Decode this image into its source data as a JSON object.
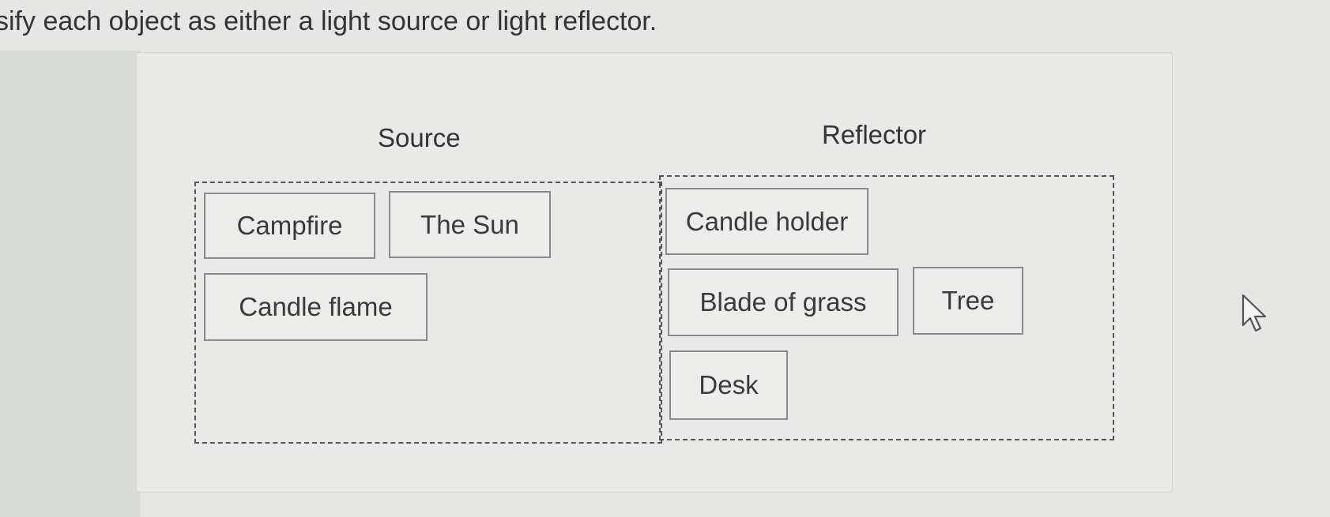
{
  "instructions": "sify each object as either a light source or light reflector.",
  "categories": {
    "source": {
      "heading": "Source",
      "items": [
        "Campfire",
        "The Sun",
        "Candle flame"
      ]
    },
    "reflector": {
      "heading": "Reflector",
      "items": [
        "Candle holder",
        "Blade of grass",
        "Tree",
        "Desk"
      ]
    }
  },
  "icons": {
    "cursor": "mouse-pointer-icon"
  }
}
